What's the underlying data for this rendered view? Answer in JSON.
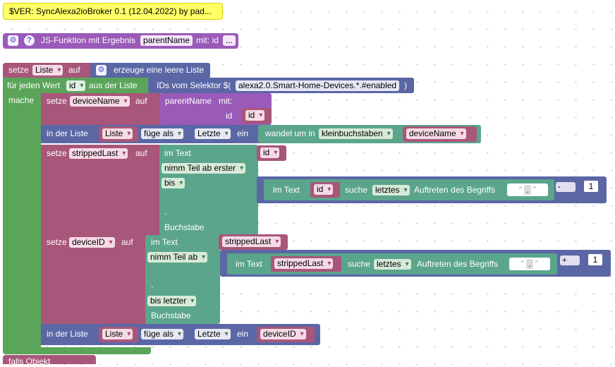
{
  "comment_block": {
    "text": "$VER: SyncAlexa2ioBroker 0.1 (12.04.2022) by pad..."
  },
  "function_block": {
    "label": "JS-Funktion mit Ergebnis",
    "name": "parentName",
    "with_label": "mit: id",
    "more": "..."
  },
  "set_list": {
    "label": "setze",
    "var": "Liste",
    "to": "auf",
    "create": "erzeuge eine leere Liste"
  },
  "for_each": {
    "label": "für jeden Wert",
    "var": "id",
    "from": "aus der Liste",
    "selector_label": "IDs vom Selektor $(",
    "selector_value": "alexa2.0.Smart-Home-Devices.*.#enabled",
    "close": ")",
    "do": "mache"
  },
  "set_device_name": {
    "label": "setze",
    "var": "deviceName",
    "to": "auf",
    "call": "parentName",
    "with": "mit:",
    "param": "id",
    "param_value": "id"
  },
  "list_insert_1": {
    "in_list": "in der Liste",
    "list": "Liste",
    "mode": "füge als",
    "where": "Letzte",
    "one": "ein",
    "convert": "wandel um in",
    "case": "kleinbuchstaben",
    "value": "deviceName"
  },
  "set_stripped": {
    "label": "setze",
    "var": "strippedLast",
    "to": "auf",
    "in_text": "im Text",
    "text_var": "id",
    "take": "nimm Teil ab erster",
    "until": "bis",
    "dot": ".",
    "letter": "Buchstabe",
    "inner_in_text": "im Text",
    "inner_var": "id",
    "find": "suche",
    "which": "letztes",
    "occur": "Auftreten des Begriffs",
    "quote_open": "“",
    "quote_char": ".",
    "quote_close": "”",
    "op": "-",
    "num": "1"
  },
  "set_device_id": {
    "label": "setze",
    "var": "deviceID",
    "to": "auf",
    "in_text": "im Text",
    "text_var": "strippedLast",
    "take": "nimm Teil ab",
    "dot": ".",
    "until": "bis letzter",
    "letter": "Buchstabe",
    "inner_in_text": "im Text",
    "inner_var": "strippedLast",
    "find": "suche",
    "which": "letztes",
    "occur": "Auftreten des Begriffs",
    "quote_open": "“",
    "quote_char": ".",
    "quote_close": "”",
    "op": "+",
    "num": "1"
  },
  "list_insert_2": {
    "in_list": "in der Liste",
    "list": "Liste",
    "mode": "füge als",
    "where": "Letzte",
    "one": "ein",
    "value": "deviceID"
  },
  "if_block": {
    "label": "falls Objekt"
  },
  "colors": {
    "yellow": "#ffff66",
    "purple": "#9a5ab8",
    "pink": "#a8567a",
    "green": "#5ba55b",
    "teal": "#5ba58c",
    "blue": "#5b67a5",
    "tealdark": "#4c9a7d"
  }
}
